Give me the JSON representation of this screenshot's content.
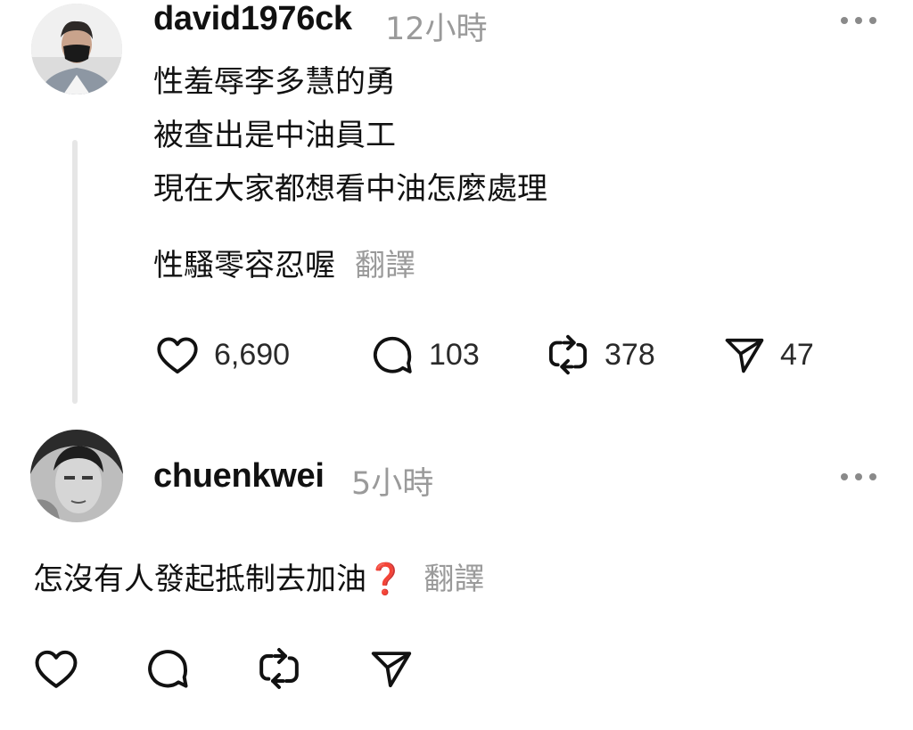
{
  "post": {
    "username": "david1976ck",
    "time": "12小時",
    "lines": [
      "性羞辱李多慧的勇",
      "被查出是中油員工",
      "現在大家都想看中油怎麼處理"
    ],
    "last_line": "性騷零容忍喔",
    "translate_label": "翻譯",
    "actions": {
      "likes": "6,690",
      "replies": "103",
      "reposts": "378",
      "shares": "47"
    }
  },
  "reply": {
    "username": "chuenkwei",
    "time": "5小時",
    "text": "怎沒有人發起抵制去加油",
    "emoji": "❓",
    "translate_label": "翻譯"
  },
  "icons": [
    "heart-icon",
    "comment-icon",
    "repost-icon",
    "send-icon",
    "more-icon"
  ],
  "colors": {
    "text": "#111111",
    "muted": "#9a9a9a",
    "thread_line": "#e6e6e6",
    "question_mark": "#d72c3c"
  }
}
